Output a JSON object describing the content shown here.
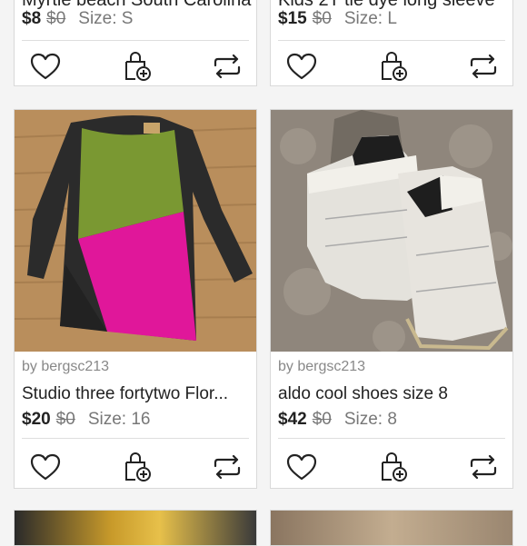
{
  "listings_top": [
    {
      "title_partial": "Myrtle beach South Carolina",
      "price": "$8",
      "original_price": "$0",
      "size": "Size: S"
    },
    {
      "title_partial": "Kids 2T tie dye long sleeve",
      "price": "$15",
      "original_price": "$0",
      "size": "Size: L"
    }
  ],
  "listings": [
    {
      "seller": "by bergsc213",
      "title": "Studio three fortytwo Flor...",
      "price": "$20",
      "original_price": "$0",
      "size": "Size: 16"
    },
    {
      "seller": "by bergsc213",
      "title": "aldo cool shoes size 8",
      "price": "$42",
      "original_price": "$0",
      "size": "Size: 8"
    }
  ],
  "actions": {
    "like_icon": "heart-icon",
    "bundle_icon": "shopping-bag-plus-icon",
    "share_icon": "repost-arrows-icon"
  },
  "colors": {
    "text": "#222222",
    "muted": "#777777",
    "border": "#d9d9d9"
  }
}
